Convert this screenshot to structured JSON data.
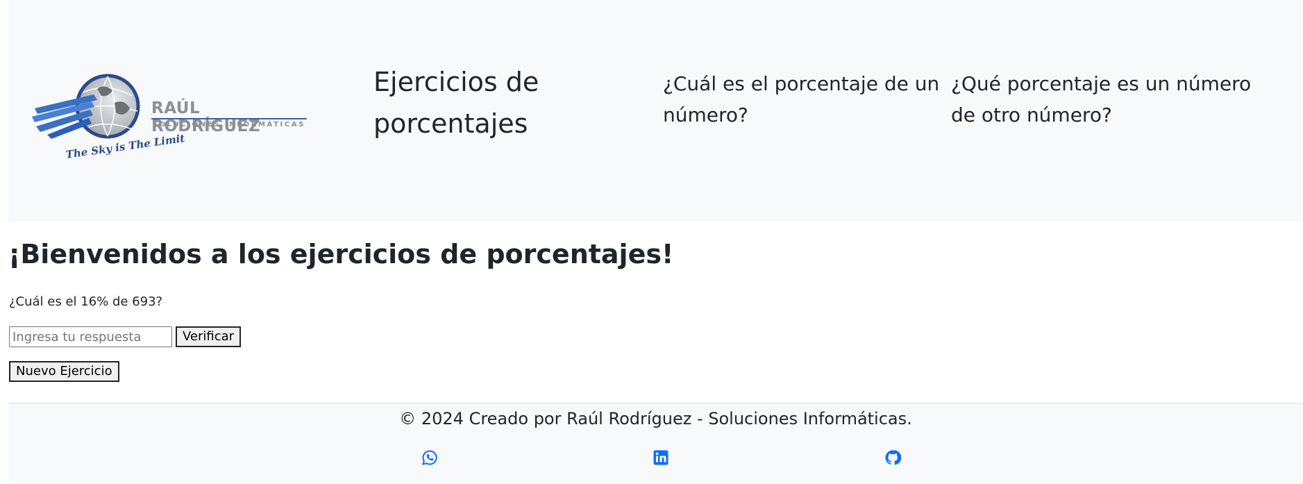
{
  "header": {
    "logo": {
      "name": "RAÚL RODRÍGUEZ",
      "subtitle": "SOLUCIONES INFORMÁTICAS",
      "tagline": "The Sky is The Limit"
    },
    "brand": "Ejercicios de porcentajes",
    "nav": [
      {
        "label": "¿Cuál es el porcentaje de un número?"
      },
      {
        "label": "¿Qué porcentaje es un número de otro número?"
      }
    ]
  },
  "main": {
    "title": "¡Bienvenidos a los ejercicios de porcentajes!",
    "question": "¿Cuál es el 16% de 693?",
    "answer_input": {
      "value": "",
      "placeholder": "Ingresa tu respuesta"
    },
    "verify_label": "Verificar",
    "new_exercise_label": "Nuevo Ejercicio"
  },
  "footer": {
    "copyright": "© 2024 Creado por Raúl Rodríguez - Soluciones Informáticas.",
    "social": [
      {
        "icon": "whatsapp-icon"
      },
      {
        "icon": "linkedin-icon"
      },
      {
        "icon": "github-icon"
      }
    ]
  },
  "colors": {
    "header_bg": "#f8f9fa",
    "link_blue": "#0d6efd",
    "logo_blue": "#2c4a8a",
    "logo_gray": "#8c8f94"
  }
}
